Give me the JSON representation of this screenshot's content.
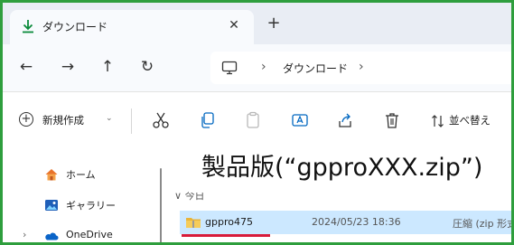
{
  "window": {
    "tab_title": "ダウンロード",
    "tab_close": "✕",
    "new_tab": "+"
  },
  "address_bar": {
    "back": "←",
    "forward": "→",
    "up": "↑",
    "refresh": "↻",
    "separator": "›",
    "breadcrumb": "ダウンロード"
  },
  "command_bar": {
    "new_label": "新規作成",
    "new_chevron": "⌄",
    "sort_label": "並べ替え",
    "icons": [
      "cut-icon",
      "copy-icon",
      "paste-icon",
      "rename-icon",
      "share-icon",
      "delete-icon",
      "sort-icon"
    ]
  },
  "sidebar": {
    "items": [
      {
        "label": "ホーム",
        "icon": "home-icon"
      },
      {
        "label": "ギャラリー",
        "icon": "gallery-icon"
      },
      {
        "label": "OneDrive",
        "icon": "onedrive-icon",
        "chevron": "›"
      }
    ]
  },
  "content": {
    "group_header": "今日",
    "group_chevron": "∨",
    "files": [
      {
        "name": "gppro475",
        "date": "2024/05/23 18:36",
        "type": "圧縮 (zip 形式"
      }
    ]
  },
  "annotation": {
    "text": "製品版(“gpproXXX.zip”)"
  },
  "colors": {
    "frame_border": "#2e9e3d",
    "selection": "#cce8ff",
    "underline": "#d81b3a",
    "accent": "#0067c0"
  }
}
